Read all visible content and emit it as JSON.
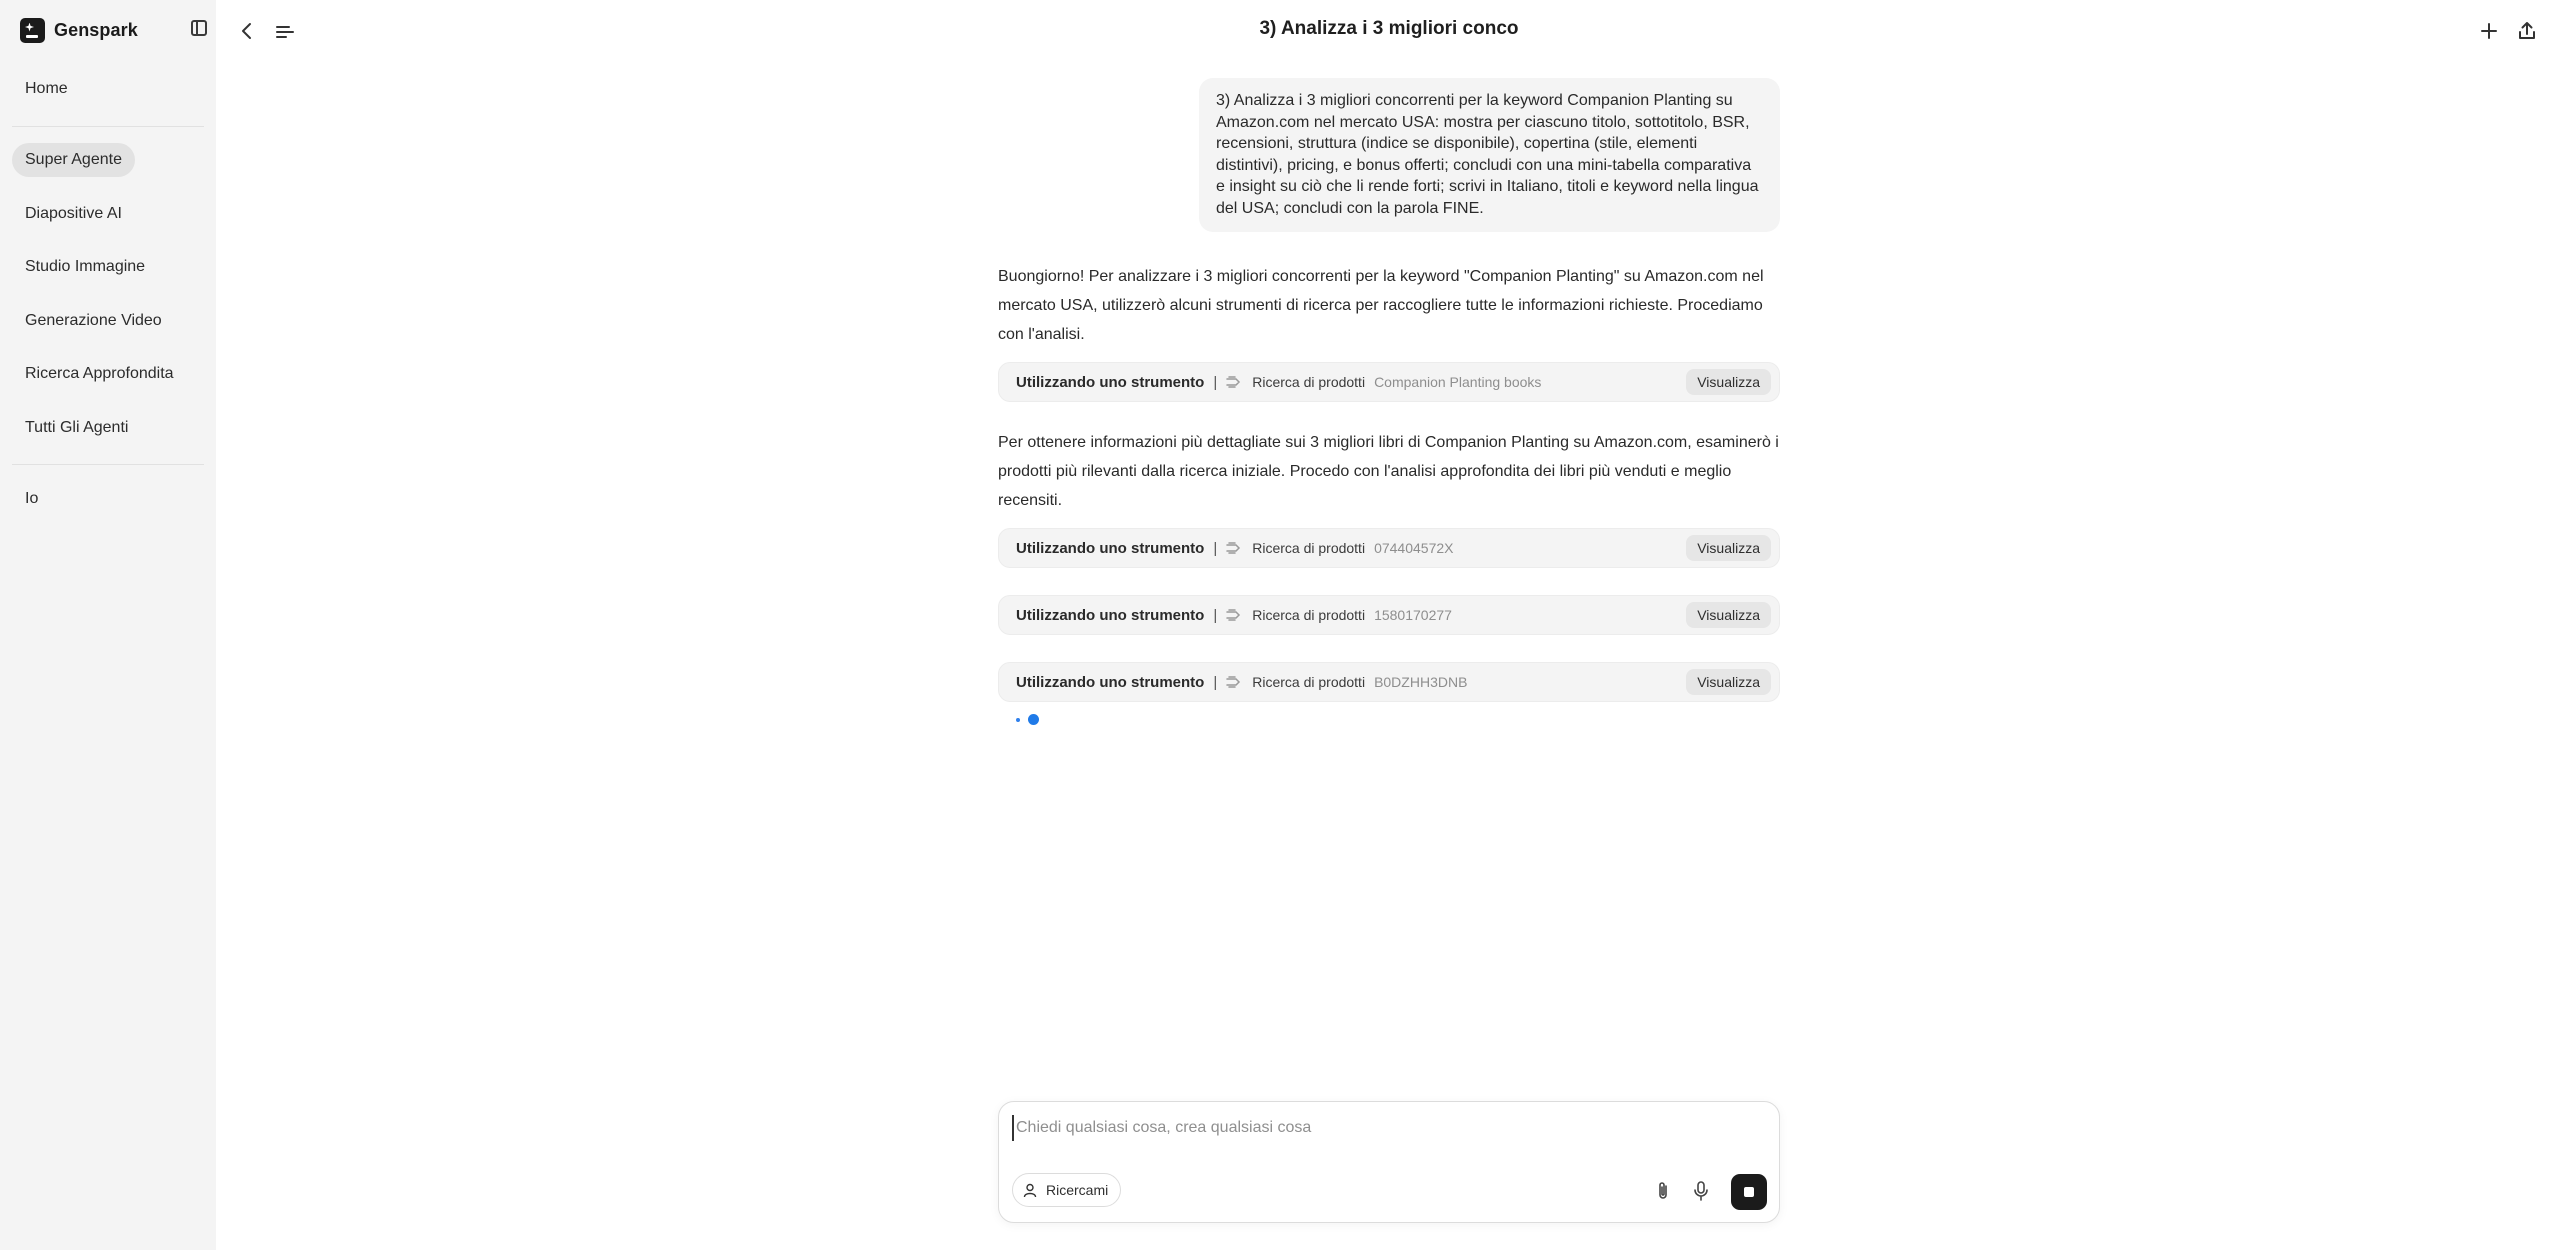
{
  "sidebar": {
    "brand": "Genspark",
    "items": [
      {
        "label": "Home"
      },
      {
        "label": "Super Agente",
        "active": true
      },
      {
        "label": "Diapositive AI"
      },
      {
        "label": "Studio Immagine"
      },
      {
        "label": "Generazione Video"
      },
      {
        "label": "Ricerca Approfondita"
      },
      {
        "label": "Tutti Gli Agenti"
      },
      {
        "label": "Io"
      }
    ]
  },
  "header": {
    "title": "3) Analizza i 3 migliori conco"
  },
  "chat": {
    "user_message": "3) Analizza i 3 migliori concorrenti per la keyword Companion Planting su Amazon.com nel mercato USA: mostra per ciascuno titolo, sottotitolo, BSR, recensioni, struttura (indice se disponibile), copertina (stile, elementi distintivi), pricing, e bonus offerti; concludi con una mini-tabella comparativa e insight su ciò che li rende forti; scrivi in Italiano, titoli e keyword nella lingua del USA; concludi con la parola FINE.",
    "ai_intro": "Buongiorno! Per analizzare i 3 migliori concorrenti per la keyword \"Companion Planting\" su Amazon.com nel mercato USA, utilizzerò alcuni strumenti di ricerca per raccogliere tutte le informazioni richieste. Procediamo con l'analisi.",
    "ai_followup": "Per ottenere informazioni più dettagliate sui 3 migliori libri di Companion Planting su Amazon.com, esaminerò i prodotti più rilevanti dalla ricerca iniziale. Procedo con l'analisi approfondita dei libri più venduti e meglio recensiti.",
    "tools": [
      {
        "title": "Utilizzando uno strumento",
        "sep": "|",
        "name": "Ricerca di prodotti",
        "query": "Companion Planting books",
        "action": "Visualizza"
      },
      {
        "title": "Utilizzando uno strumento",
        "sep": "|",
        "name": "Ricerca di prodotti",
        "query": "074404572X",
        "action": "Visualizza"
      },
      {
        "title": "Utilizzando uno strumento",
        "sep": "|",
        "name": "Ricerca di prodotti",
        "query": "1580170277",
        "action": "Visualizza"
      },
      {
        "title": "Utilizzando uno strumento",
        "sep": "|",
        "name": "Ricerca di prodotti",
        "query": "B0DZHH3DNB",
        "action": "Visualizza"
      }
    ]
  },
  "composer": {
    "placeholder": "Chiedi qualsiasi cosa, crea qualsiasi cosa",
    "value": "",
    "research_label": "Ricercami"
  },
  "colors": {
    "accent_blue": "#1f7ae8",
    "sidebar_bg": "#f4f4f4",
    "stop_button": "#1b1b1b"
  }
}
